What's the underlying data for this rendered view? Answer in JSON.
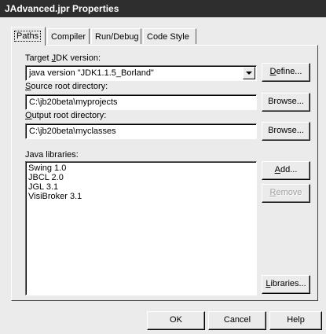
{
  "window": {
    "title": "JAdvanced.jpr Properties"
  },
  "tabs": [
    {
      "label": "Paths",
      "active": true
    },
    {
      "label": "Compiler",
      "active": false
    },
    {
      "label": "Run/Debug",
      "active": false
    },
    {
      "label": "Code Style",
      "active": false
    }
  ],
  "paths": {
    "target_jdk": {
      "label_pre": "Target ",
      "label_key": "J",
      "label_post": "DK version:",
      "value": "java version \"JDK1.1.5_Borland\"",
      "define_key": "D",
      "define_rest": "efine..."
    },
    "source_root": {
      "label_key": "S",
      "label_post": "ource root directory:",
      "value": "C:\\jb20beta\\myprojects",
      "browse_label": "Browse..."
    },
    "output_root": {
      "label_key": "O",
      "label_post": "utput root directory:",
      "value": "C:\\jb20beta\\myclasses",
      "browse_label": "Browse..."
    },
    "java_libraries": {
      "label": "Java libraries:",
      "items": [
        "Swing 1.0",
        "JBCL 2.0",
        "JGL 3.1",
        "VisiBroker 3.1"
      ],
      "add_key": "A",
      "add_rest": "dd...",
      "remove_key": "R",
      "remove_rest": "emove",
      "libraries_key": "L",
      "libraries_rest": "ibraries..."
    }
  },
  "footer": {
    "ok_label": "OK",
    "cancel_label": "Cancel",
    "help_label": "Help"
  }
}
